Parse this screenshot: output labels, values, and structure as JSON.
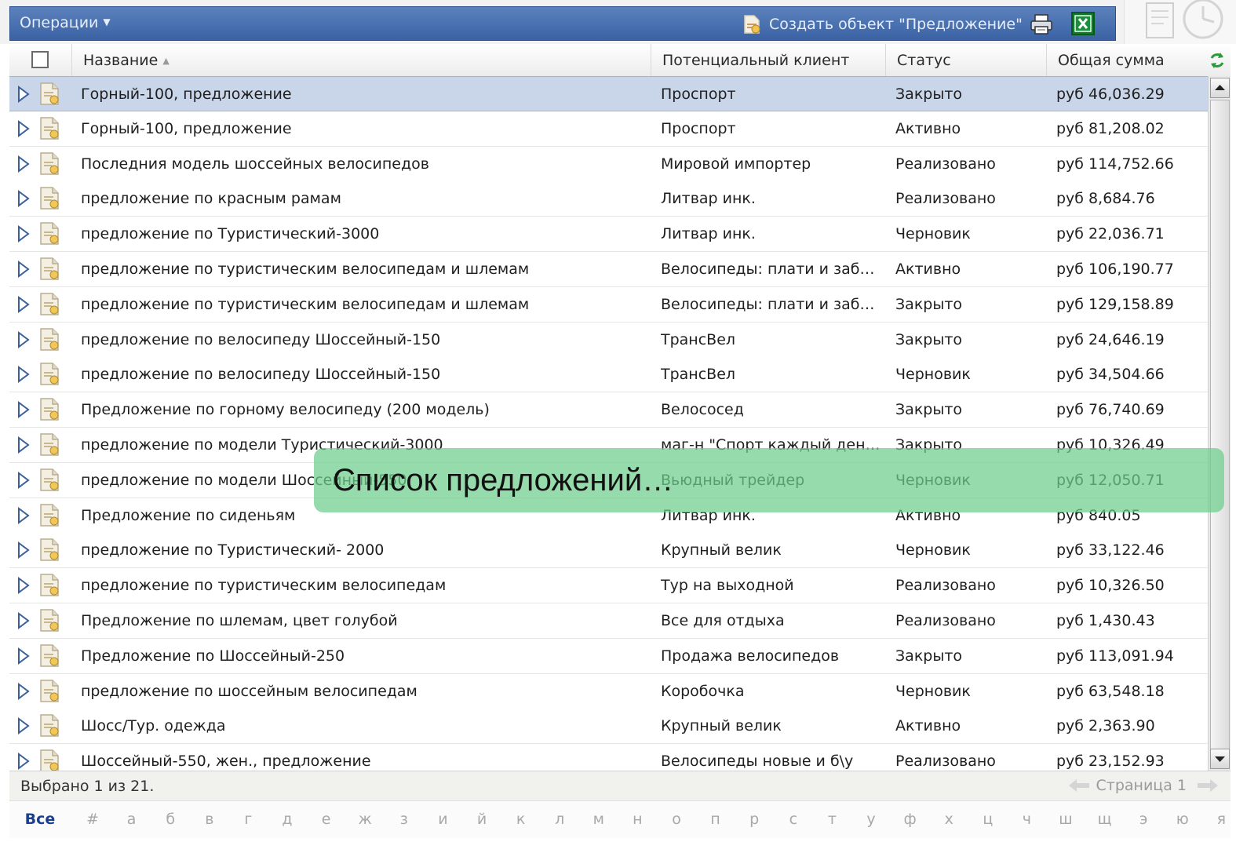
{
  "toolbar": {
    "operations_label": "Операции",
    "create_label": "Создать объект \"Предложение\""
  },
  "columns": {
    "name": "Название",
    "client": "Потенциальный клиент",
    "status": "Статус",
    "amount": "Общая сумма"
  },
  "rows": [
    {
      "name": "Горный-100, предложение",
      "client": "Проспорт",
      "status": "Закрыто",
      "amount": "руб 46,036.29"
    },
    {
      "name": "Горный-100, предложение",
      "client": "Проспорт",
      "status": "Активно",
      "amount": "руб 81,208.02"
    },
    {
      "name": "Последния модель шоссейных велосипедов",
      "client": "Мировой импортер",
      "status": "Реализовано",
      "amount": "руб 114,752.66"
    },
    {
      "name": "предложение по красным рамам",
      "client": "Литвар инк.",
      "status": "Реализовано",
      "amount": "руб 8,684.76"
    },
    {
      "name": "предложение по Туристический-3000",
      "client": "Литвар инк.",
      "status": "Черновик",
      "amount": "руб 22,036.71"
    },
    {
      "name": "предложение по туристическим велосипедам и шлемам",
      "client": "Велосипеды: плати и заби…",
      "status": "Активно",
      "amount": "руб 106,190.77"
    },
    {
      "name": "предложение по туристическим велосипедам и шлемам",
      "client": "Велосипеды: плати и заби…",
      "status": "Закрыто",
      "amount": "руб 129,158.89"
    },
    {
      "name": "предложение по велосипеду Шоссейный-150",
      "client": "ТрансВел",
      "status": "Закрыто",
      "amount": "руб 24,646.19"
    },
    {
      "name": "предложение по велосипеду Шоссейный-150",
      "client": "ТрансВел",
      "status": "Черновик",
      "amount": "руб 34,504.66"
    },
    {
      "name": "Предложение по горному велосипеду (200 модель)",
      "client": "Велососед",
      "status": "Закрыто",
      "amount": "руб 76,740.69"
    },
    {
      "name": "предложение по модели Туристический-3000",
      "client": "маг-н \"Спорт каждый день\"",
      "status": "Закрыто",
      "amount": "руб 10,326.49"
    },
    {
      "name": "предложение по модели Шоссейный-550",
      "client": "Вьюдный трейдер",
      "status": "Черновик",
      "amount": "руб 12,050.71"
    },
    {
      "name": "Предложение по сиденьям",
      "client": "Литвар инк.",
      "status": "Активно",
      "amount": "руб 840.05"
    },
    {
      "name": "предложение по Туристический- 2000",
      "client": "Крупный велик",
      "status": "Черновик",
      "amount": "руб 33,122.46"
    },
    {
      "name": "предложение по туристическим велосипедам",
      "client": "Тур на выходной",
      "status": "Реализовано",
      "amount": "руб 10,326.50"
    },
    {
      "name": "Предложение по шлемам, цвет голубой",
      "client": "Все для отдыха",
      "status": "Реализовано",
      "amount": "руб 1,430.43"
    },
    {
      "name": "Предложение по Шоссейный-250",
      "client": "Продажа велосипедов",
      "status": "Закрыто",
      "amount": "руб 113,091.94"
    },
    {
      "name": "предложение по шоссейным велосипедам",
      "client": "Коробочка",
      "status": "Черновик",
      "amount": "руб 63,548.18"
    },
    {
      "name": "Шосс/Тур. одежда",
      "client": "Крупный велик",
      "status": "Активно",
      "amount": "руб 2,363.90"
    },
    {
      "name": "Шоссейный-550, жен., предложение",
      "client": "Велосипеды новые и б\\у",
      "status": "Реализовано",
      "amount": "руб 23,152.93"
    }
  ],
  "selected_row": 0,
  "status_bar": {
    "selection_text": "Выбрано 1 из 21.",
    "page_text": "Страница 1"
  },
  "alphabet": [
    "Все",
    "#",
    "а",
    "б",
    "в",
    "г",
    "д",
    "е",
    "ж",
    "з",
    "и",
    "й",
    "к",
    "л",
    "м",
    "н",
    "о",
    "п",
    "р",
    "с",
    "т",
    "у",
    "ф",
    "х",
    "ц",
    "ч",
    "ш",
    "щ",
    "э",
    "ю",
    "я"
  ],
  "overlay": {
    "text": "Список предложений…"
  },
  "colors": {
    "toolbar": "#4a72b2",
    "selected_row": "#c9d5e8",
    "overlay": "#6ecd8c"
  },
  "icons": {
    "expand": "triangle-right-icon",
    "record": "quote-document-icon",
    "print": "printer-icon",
    "excel": "excel-export-icon",
    "refresh": "refresh-icon"
  }
}
